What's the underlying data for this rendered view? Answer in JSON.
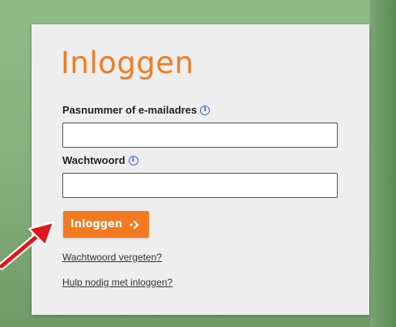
{
  "login": {
    "title": "Inloggen",
    "username_label": "Pasnummer of e-mailadres",
    "username_value": "",
    "password_label": "Wachtwoord",
    "password_value": "",
    "submit_label": "Inloggen",
    "forgot_password_link": "Wachtwoord vergeten?",
    "help_link": "Hulp nodig met inloggen?"
  },
  "icons": {
    "info": "info-icon",
    "submit_arrow": "double-chevron-right-icon",
    "annotation": "red-arrow-icon"
  },
  "colors": {
    "brand_orange": "#f47a20",
    "title_orange": "#f07c22",
    "info_blue": "#2f6fd0",
    "annotation_red": "#e0161c",
    "card_background": "#eeeeee"
  }
}
